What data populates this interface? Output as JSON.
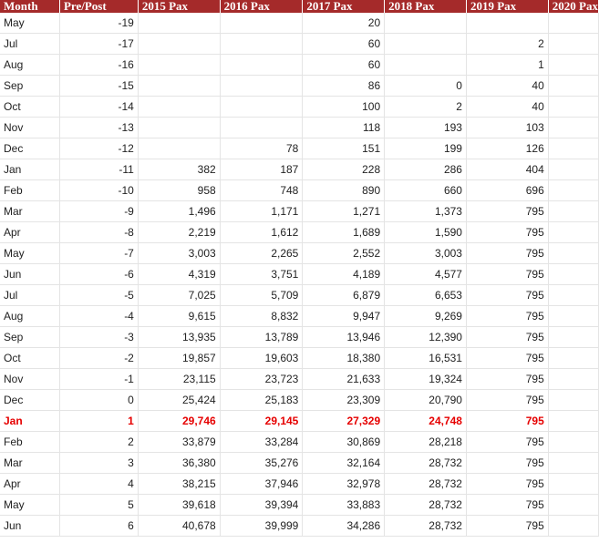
{
  "table": {
    "columns": [
      "Month",
      "Pre/Post",
      "2015 Pax",
      "2016 Pax",
      "2017 Pax",
      "2018 Pax",
      "2019 Pax",
      "2020 Pax"
    ],
    "highlight_color": "#e60000",
    "header_color": "#a52a2a",
    "rows": [
      {
        "cells": [
          "May",
          "-19",
          "",
          "",
          "20",
          "",
          "",
          ""
        ],
        "highlight": false
      },
      {
        "cells": [
          "Jul",
          "-17",
          "",
          "",
          "60",
          "",
          "2",
          ""
        ],
        "highlight": false
      },
      {
        "cells": [
          "Aug",
          "-16",
          "",
          "",
          "60",
          "",
          "1",
          ""
        ],
        "highlight": false
      },
      {
        "cells": [
          "Sep",
          "-15",
          "",
          "",
          "86",
          "0",
          "40",
          ""
        ],
        "highlight": false
      },
      {
        "cells": [
          "Oct",
          "-14",
          "",
          "",
          "100",
          "2",
          "40",
          ""
        ],
        "highlight": false
      },
      {
        "cells": [
          "Nov",
          "-13",
          "",
          "",
          "118",
          "193",
          "103",
          ""
        ],
        "highlight": false
      },
      {
        "cells": [
          "Dec",
          "-12",
          "",
          "78",
          "151",
          "199",
          "126",
          ""
        ],
        "highlight": false
      },
      {
        "cells": [
          "Jan",
          "-11",
          "382",
          "187",
          "228",
          "286",
          "404",
          ""
        ],
        "highlight": false
      },
      {
        "cells": [
          "Feb",
          "-10",
          "958",
          "748",
          "890",
          "660",
          "696",
          ""
        ],
        "highlight": false
      },
      {
        "cells": [
          "Mar",
          "-9",
          "1,496",
          "1,171",
          "1,271",
          "1,373",
          "795",
          ""
        ],
        "highlight": false
      },
      {
        "cells": [
          "Apr",
          "-8",
          "2,219",
          "1,612",
          "1,689",
          "1,590",
          "795",
          ""
        ],
        "highlight": false
      },
      {
        "cells": [
          "May",
          "-7",
          "3,003",
          "2,265",
          "2,552",
          "3,003",
          "795",
          ""
        ],
        "highlight": false
      },
      {
        "cells": [
          "Jun",
          "-6",
          "4,319",
          "3,751",
          "4,189",
          "4,577",
          "795",
          ""
        ],
        "highlight": false
      },
      {
        "cells": [
          "Jul",
          "-5",
          "7,025",
          "5,709",
          "6,879",
          "6,653",
          "795",
          ""
        ],
        "highlight": false
      },
      {
        "cells": [
          "Aug",
          "-4",
          "9,615",
          "8,832",
          "9,947",
          "9,269",
          "795",
          ""
        ],
        "highlight": false
      },
      {
        "cells": [
          "Sep",
          "-3",
          "13,935",
          "13,789",
          "13,946",
          "12,390",
          "795",
          ""
        ],
        "highlight": false
      },
      {
        "cells": [
          "Oct",
          "-2",
          "19,857",
          "19,603",
          "18,380",
          "16,531",
          "795",
          ""
        ],
        "highlight": false
      },
      {
        "cells": [
          "Nov",
          "-1",
          "23,115",
          "23,723",
          "21,633",
          "19,324",
          "795",
          ""
        ],
        "highlight": false
      },
      {
        "cells": [
          "Dec",
          "0",
          "25,424",
          "25,183",
          "23,309",
          "20,790",
          "795",
          ""
        ],
        "highlight": false
      },
      {
        "cells": [
          "Jan",
          "1",
          "29,746",
          "29,145",
          "27,329",
          "24,748",
          "795",
          ""
        ],
        "highlight": true
      },
      {
        "cells": [
          "Feb",
          "2",
          "33,879",
          "33,284",
          "30,869",
          "28,218",
          "795",
          ""
        ],
        "highlight": false
      },
      {
        "cells": [
          "Mar",
          "3",
          "36,380",
          "35,276",
          "32,164",
          "28,732",
          "795",
          ""
        ],
        "highlight": false
      },
      {
        "cells": [
          "Apr",
          "4",
          "38,215",
          "37,946",
          "32,978",
          "28,732",
          "795",
          ""
        ],
        "highlight": false
      },
      {
        "cells": [
          "May",
          "5",
          "39,618",
          "39,394",
          "33,883",
          "28,732",
          "795",
          ""
        ],
        "highlight": false
      },
      {
        "cells": [
          "Jun",
          "6",
          "40,678",
          "39,999",
          "34,286",
          "28,732",
          "795",
          ""
        ],
        "highlight": false
      }
    ]
  }
}
